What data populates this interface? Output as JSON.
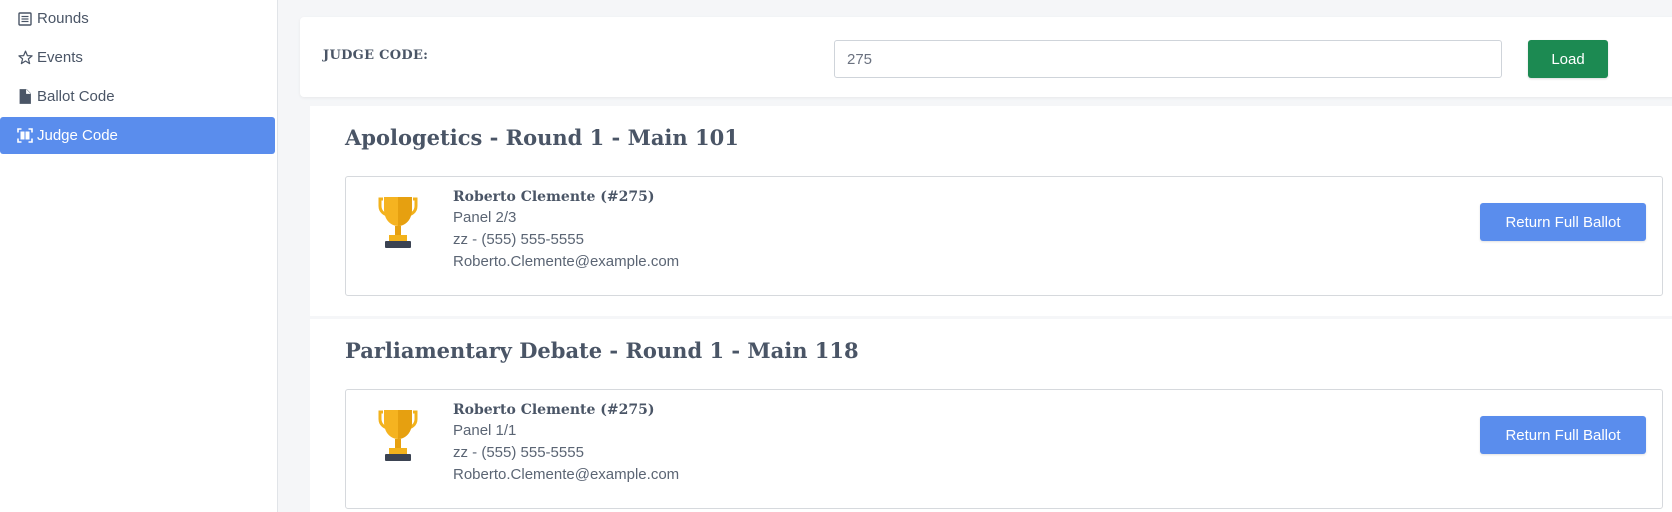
{
  "sidebar": {
    "items": [
      {
        "label": "Rounds",
        "icon": "list-icon",
        "active": false
      },
      {
        "label": "Events",
        "icon": "star-icon",
        "active": false
      },
      {
        "label": "Ballot Code",
        "icon": "file-icon",
        "active": false
      },
      {
        "label": "Judge Code",
        "icon": "qr-scan-icon",
        "active": true
      }
    ]
  },
  "judge_search": {
    "label": "JUDGE CODE:",
    "value": "275",
    "button_label": "Load"
  },
  "assignments": [
    {
      "title": "Apologetics - Round 1 - Main 101",
      "judge_name": "Roberto Clemente (#275)",
      "panel": "Panel 2/3",
      "phone": "zz - (555) 555-5555",
      "email": "Roberto.Clemente@example.com",
      "button_label": "Return Full Ballot",
      "icon": "trophy-icon"
    },
    {
      "title": "Parliamentary Debate - Round 1 - Main 118",
      "judge_name": "Roberto Clemente (#275)",
      "panel": "Panel 1/1",
      "phone": "zz - (555) 555-5555",
      "email": "Roberto.Clemente@example.com",
      "button_label": "Return Full Ballot",
      "icon": "trophy-icon"
    }
  ],
  "colors": {
    "active_nav": "#5a8ded",
    "load_button": "#1c8a52",
    "return_button": "#5a8ded",
    "text": "#4a5566"
  }
}
